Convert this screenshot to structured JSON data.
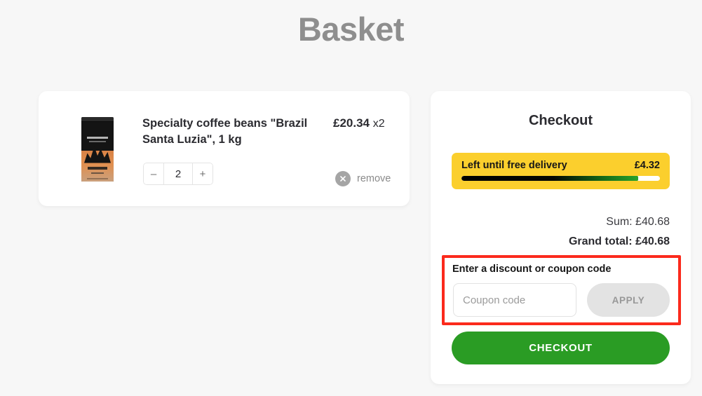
{
  "page": {
    "title": "Basket",
    "background_color": "#f7f7f7"
  },
  "basket": {
    "items": [
      {
        "name": "Specialty coffee beans \"Brazil Santa Luzia\", 1 kg",
        "price": "£20.34",
        "multiplier": "x2",
        "quantity": "2",
        "decrement_label": "–",
        "increment_label": "+",
        "remove_label": "remove",
        "remove_icon": "close-circle-icon",
        "image_alt": "coffee-bag-thumbnail"
      }
    ]
  },
  "checkout": {
    "title": "Checkout",
    "free_delivery": {
      "label": "Left until free delivery",
      "amount": "£4.32",
      "progress_percent": 89,
      "banner_color": "#fbcf2d",
      "fill_start_color": "#000000",
      "fill_end_color": "#28a32c",
      "track_color": "#ffffff"
    },
    "totals": {
      "sum_label": "Sum: £40.68",
      "grand_total_label": "Grand total: £40.68"
    },
    "coupon": {
      "title": "Enter a discount or coupon code",
      "input_value": "",
      "input_placeholder": "Coupon code",
      "apply_label": "APPLY",
      "highlight_color": "#fb2a1c",
      "apply_background": "#e3e3e3",
      "apply_text_color": "#989898"
    },
    "submit": {
      "label": "CHECKOUT",
      "color": "#2a9c24"
    }
  }
}
